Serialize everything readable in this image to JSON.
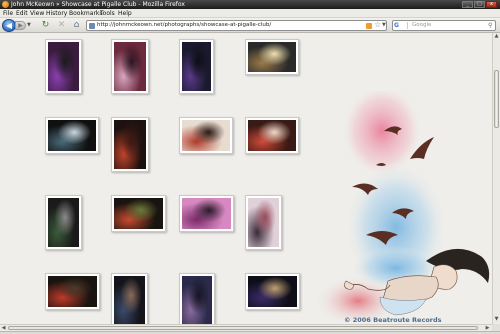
{
  "window": {
    "title": "John McKeown » Showcase at Pigalle Club - Mozilla Firefox",
    "controls": [
      "_",
      "□",
      "x"
    ]
  },
  "menu": [
    "File",
    "Edit",
    "View",
    "History",
    "Bookmarks",
    "Tools",
    "Help"
  ],
  "toolbar": {
    "url": "http://johnmckeown.net/photographs/showcase-at-pigalle-club/",
    "search_engine": "G",
    "search_placeholder": "Google",
    "icons": [
      "back-icon",
      "forward-icon",
      "reload-icon",
      "stop-icon",
      "home-icon",
      "rss-icon",
      "star-icon",
      "search-icon"
    ]
  },
  "page": {
    "copyright": "© 2006 Beatroute Records",
    "photos": [
      {
        "alt": "photo-1",
        "colors": [
          "#3a1d3e",
          "#8a3fb0",
          "#1a1a1a"
        ]
      },
      {
        "alt": "photo-2",
        "colors": [
          "#6b2a3d",
          "#d8a6c0",
          "#2a1420"
        ]
      },
      {
        "alt": "photo-3",
        "colors": [
          "#1a1a2e",
          "#5a3a8a",
          "#0d0d14"
        ]
      },
      {
        "alt": "photo-4",
        "colors": [
          "#2a2a2a",
          "#9a7a4a",
          "#f0e0b0"
        ]
      },
      {
        "alt": "photo-5",
        "colors": [
          "#101010",
          "#4a6a7a",
          "#c8d8e0"
        ]
      },
      {
        "alt": "photo-6",
        "colors": [
          "#1e1210",
          "#c0442a",
          "#3a1a14"
        ]
      },
      {
        "alt": "photo-7",
        "colors": [
          "#e8dcd0",
          "#b03a2a",
          "#2a1a14"
        ]
      },
      {
        "alt": "photo-8",
        "colors": [
          "#3a1a14",
          "#d04a3a",
          "#f0d8c8"
        ]
      },
      {
        "alt": "photo-9",
        "colors": [
          "#1a1a1a",
          "#3a5a3a",
          "#8a8a8a"
        ]
      },
      {
        "alt": "photo-10",
        "colors": [
          "#1a1410",
          "#c84a30",
          "#6a7a3a"
        ]
      },
      {
        "alt": "photo-11",
        "colors": [
          "#d888c0",
          "#7a2a6a",
          "#2a1a2a"
        ]
      },
      {
        "alt": "photo-12",
        "colors": [
          "#e0d0d8",
          "#3a2a3a",
          "#9a4a5a"
        ]
      },
      {
        "alt": "photo-13",
        "colors": [
          "#1a1410",
          "#c03a2a",
          "#4a3a2a"
        ]
      },
      {
        "alt": "photo-14",
        "colors": [
          "#14141a",
          "#3a4a6a",
          "#8a6a5a"
        ]
      },
      {
        "alt": "photo-15",
        "colors": [
          "#2a2a4a",
          "#8a6aa0",
          "#141420"
        ]
      },
      {
        "alt": "photo-16",
        "colors": [
          "#0e0e18",
          "#3a2a6a",
          "#c0a070"
        ]
      }
    ]
  },
  "colors": {
    "accent": "#2e6cc0",
    "copyright": "#4b6d8a"
  }
}
